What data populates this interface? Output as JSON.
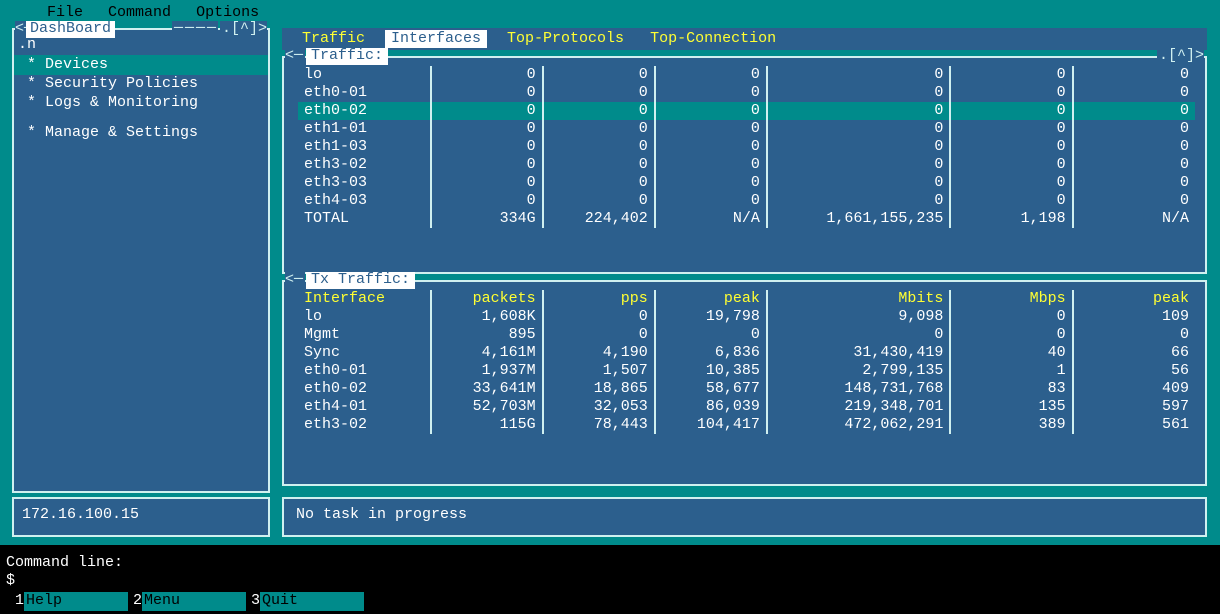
{
  "menubar": {
    "file": "File",
    "command": "Command",
    "options": "Options"
  },
  "sidebar": {
    "title": "DashBoard",
    "items": [
      {
        "label": ".n"
      },
      {
        "label": " * Devices"
      },
      {
        "label": " * Security Policies"
      },
      {
        "label": " * Logs & Monitoring"
      },
      {
        "label": " * Manage & Settings"
      }
    ]
  },
  "tabs": [
    "Traffic",
    "Interfaces",
    "Top-Protocols",
    "Top-Connection"
  ],
  "traffic": {
    "title": "Traffic:",
    "highlight_index": 2,
    "rows": [
      [
        "lo",
        "0",
        "0",
        "0",
        "0",
        "0",
        "0"
      ],
      [
        "eth0-01",
        "0",
        "0",
        "0",
        "0",
        "0",
        "0"
      ],
      [
        "eth0-02",
        "0",
        "0",
        "0",
        "0",
        "0",
        "0"
      ],
      [
        "eth1-01",
        "0",
        "0",
        "0",
        "0",
        "0",
        "0"
      ],
      [
        "eth1-03",
        "0",
        "0",
        "0",
        "0",
        "0",
        "0"
      ],
      [
        "eth3-02",
        "0",
        "0",
        "0",
        "0",
        "0",
        "0"
      ],
      [
        "eth3-03",
        "0",
        "0",
        "0",
        "0",
        "0",
        "0"
      ],
      [
        "eth4-03",
        "0",
        "0",
        "0",
        "0",
        "0",
        "0"
      ],
      [
        "TOTAL",
        "334G",
        "224,402",
        "N/A",
        "1,661,155,235",
        "1,198",
        "N/A"
      ]
    ]
  },
  "tx": {
    "title": "Tx Traffic:",
    "headers": [
      "Interface",
      "packets",
      "pps",
      "peak",
      "Mbits",
      "Mbps",
      "peak"
    ],
    "rows": [
      [
        "lo",
        "1,608K",
        "0",
        "19,798",
        "9,098",
        "0",
        "109"
      ],
      [
        "Mgmt",
        "895",
        "0",
        "0",
        "0",
        "0",
        "0"
      ],
      [
        "Sync",
        "4,161M",
        "4,190",
        "6,836",
        "31,430,419",
        "40",
        "66"
      ],
      [
        "eth0-01",
        "1,937M",
        "1,507",
        "10,385",
        "2,799,135",
        "1",
        "56"
      ],
      [
        "eth0-02",
        "33,641M",
        "18,865",
        "58,677",
        "148,731,768",
        "83",
        "409"
      ],
      [
        "eth4-01",
        "52,703M",
        "32,053",
        "86,039",
        "219,348,701",
        "135",
        "597"
      ],
      [
        "eth3-02",
        "115G",
        "78,443",
        "104,417",
        "472,062,291",
        "389",
        "561"
      ]
    ]
  },
  "ipbox": "172.16.100.15",
  "taskbox": "No task in progress",
  "cmdline": {
    "label": "Command line:",
    "prompt": "$"
  },
  "footer": [
    {
      "num": "1",
      "label": "Help"
    },
    {
      "num": "2",
      "label": "Menu"
    },
    {
      "num": "3",
      "label": "Quit"
    }
  ]
}
